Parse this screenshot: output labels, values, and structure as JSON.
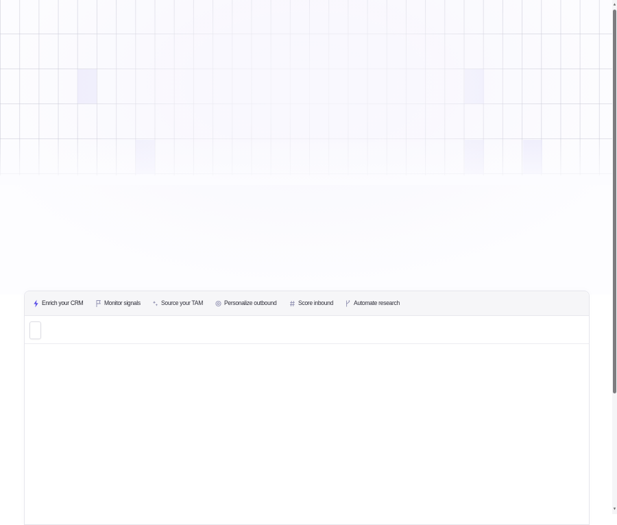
{
  "accent_color": "#5b4fe8",
  "tabs": [
    {
      "label": "Enrich your CRM",
      "icon": "lightning-icon",
      "active": true
    },
    {
      "label": "Monitor signals",
      "icon": "flag-icon",
      "active": false
    },
    {
      "label": "Source your TAM",
      "icon": "sparkle-icon",
      "active": false
    },
    {
      "label": "Personalize outbound",
      "icon": "at-icon",
      "active": false
    },
    {
      "label": "Score inbound",
      "icon": "hash-icon",
      "active": false
    },
    {
      "label": "Automate research",
      "icon": "branch-icon",
      "active": false
    }
  ],
  "scrollbar": {
    "up_arrow": "▲",
    "down_arrow": "▼"
  }
}
